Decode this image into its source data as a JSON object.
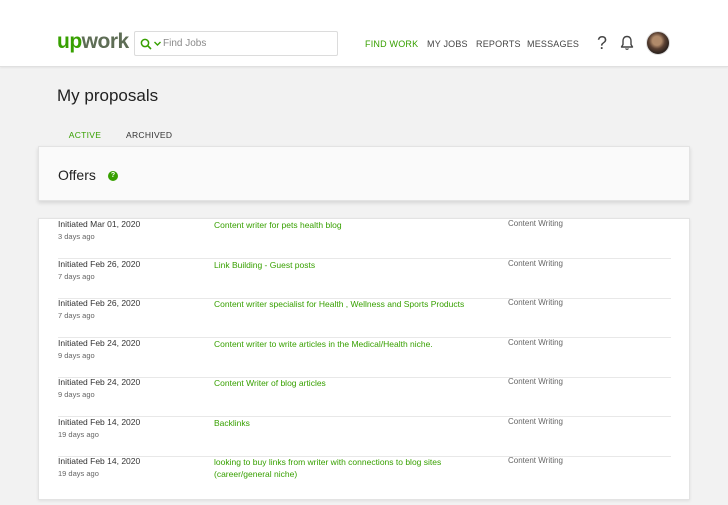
{
  "header": {
    "logo_up": "up",
    "logo_work": "work",
    "search_placeholder": "Find Jobs",
    "nav": {
      "find_work": "FIND WORK",
      "my_jobs": "MY JOBS",
      "reports": "REPORTS",
      "messages": "MESSAGES"
    },
    "help": "?"
  },
  "page": {
    "title": "My proposals",
    "tabs": {
      "active": "ACTIVE",
      "archived": "ARCHIVED"
    }
  },
  "offers": {
    "title": "Offers",
    "help": "?"
  },
  "proposals": [
    {
      "initiated": "Initiated Mar 01, 2020",
      "ago": "3 days ago",
      "job": "Content writer for pets health blog",
      "category": "Content Writing"
    },
    {
      "initiated": "Initiated Feb 26, 2020",
      "ago": "7 days ago",
      "job": "Link Building - Guest posts",
      "category": "Content Writing"
    },
    {
      "initiated": "Initiated Feb 26, 2020",
      "ago": "7 days ago",
      "job": "Content writer specialist for Health , Wellness and Sports Products",
      "category": "Content Writing"
    },
    {
      "initiated": "Initiated Feb 24, 2020",
      "ago": "9 days ago",
      "job": "Content writer to write articles in the Medical/Health niche.",
      "category": "Content Writing"
    },
    {
      "initiated": "Initiated Feb 24, 2020",
      "ago": "9 days ago",
      "job": "Content Writer of blog articles",
      "category": "Content Writing"
    },
    {
      "initiated": "Initiated Feb 14, 2020",
      "ago": "19 days ago",
      "job": "Backlinks",
      "category": "Content Writing"
    },
    {
      "initiated": "Initiated Feb 14, 2020",
      "ago": "19 days ago",
      "job": "looking to buy links from writer with connections to blog sites (career/general niche)",
      "category": "Content Writing"
    }
  ],
  "colors": {
    "brand": "#37a000",
    "logo_work": "#5e6d55"
  },
  "icons": {
    "search": "search-icon",
    "chevron": "chevron-down-icon",
    "help": "help-icon",
    "bell": "bell-icon"
  }
}
